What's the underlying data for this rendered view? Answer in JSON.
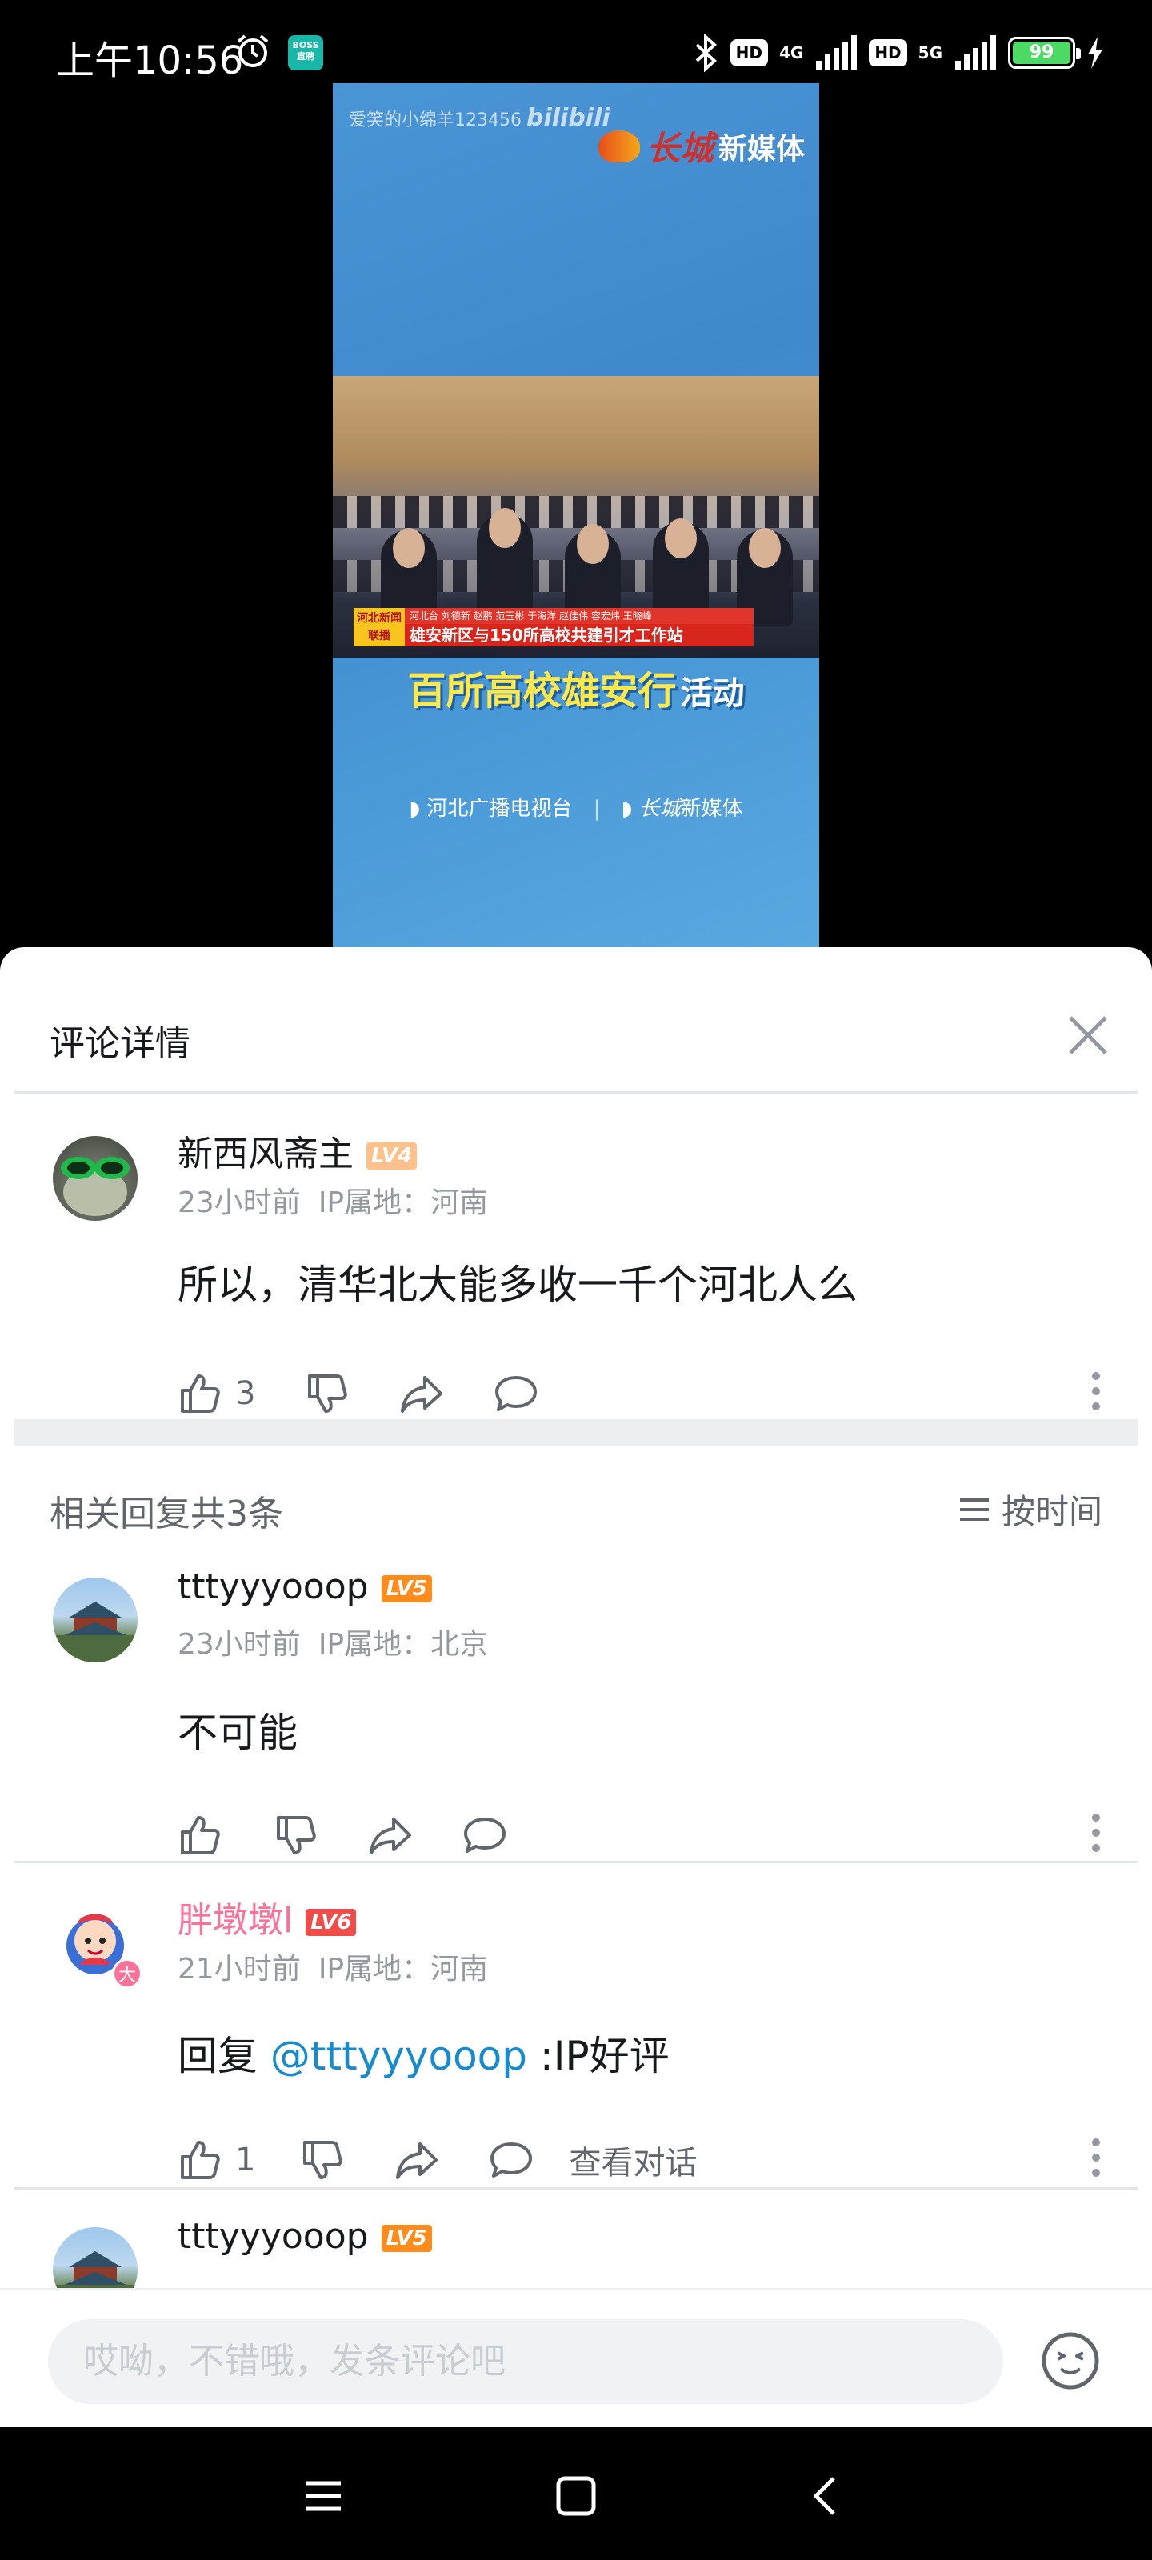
{
  "status_bar": {
    "time": "上午10:56",
    "boss_app_label": "BOSS直聘",
    "net1": "4G",
    "hd": "HD",
    "net2": "5G",
    "battery": "99"
  },
  "video": {
    "watermark": "爱笑的小绵羊123456",
    "bilibili": "bilibili",
    "media_logo": "新媒体",
    "media_logo_script": "长城",
    "caption_small": "河北台 刘德新 赵鹏 范玉彬 于海洋 赵佳伟 容宏炜 王晓峰",
    "caption_big": "雄安新区与150所高校共建引才工作站",
    "caption_tag": "河北新闻联播",
    "headline_yellow": "百所高校雄安行",
    "headline_white": "活动",
    "footer_left": "河北广播电视台",
    "footer_sep": "|",
    "footer_right": "新媒体",
    "footer_right_script": "长城"
  },
  "sheet": {
    "title": "评论详情"
  },
  "main_comment": {
    "username": "新西风斋主",
    "level": "LV4",
    "time": "23小时前",
    "ip": "IP属地：河南",
    "text": "所以，清华北大能多收一千个河北人么",
    "likes": "3"
  },
  "replies": {
    "header": "相关回复共3条",
    "sort_label": "按时间",
    "items": [
      {
        "username": "tttyyyooop",
        "level": "LV5",
        "time": "23小时前",
        "ip": "IP属地：北京",
        "text": "不可能",
        "likes": ""
      },
      {
        "username": "胖墩墩l",
        "level": "LV6",
        "time": "21小时前",
        "ip": "IP属地：河南",
        "reply_prefix": "回复 ",
        "mention": "@tttyyyooop",
        "text": " :IP好评",
        "likes": "1",
        "view_conversation": "查看对话",
        "badge": "大"
      },
      {
        "username": "tttyyyooop",
        "level": "LV5"
      }
    ]
  },
  "input": {
    "placeholder": "哎呦，不错哦，发条评论吧"
  },
  "colors": {
    "pink": "#fb7299",
    "mention": "#178bcf",
    "lv4": "#ffc08a",
    "lv5": "#ff8c1a",
    "lv6": "#f04c49"
  }
}
